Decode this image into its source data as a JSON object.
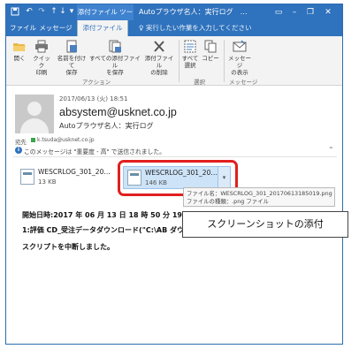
{
  "titlebar": {
    "tool_tab": "添付ファイル ツール",
    "title": "Autoプラウザ名人：実行ログ　…",
    "icons": [
      "save-icon",
      "undo-icon",
      "redo-icon",
      "up-icon",
      "down-icon",
      "customize-icon"
    ],
    "controls": [
      "ribbon-options-icon",
      "minimize-icon",
      "restore-icon",
      "close-icon"
    ]
  },
  "tabs": {
    "file": "ファイル",
    "message": "メッセージ",
    "attachment": "添付ファイル",
    "tellme": "実行したい作業を入力してください"
  },
  "ribbon": {
    "buttons": [
      {
        "label1": "開く",
        "label2": "",
        "icon": "open-folder-icon"
      },
      {
        "label1": "クイック",
        "label2": "印刷",
        "icon": "printer-icon"
      },
      {
        "label1": "名前を付けて",
        "label2": "保存",
        "icon": "save-as-icon"
      },
      {
        "label1": "すべての添付ファイル",
        "label2": "を保存",
        "icon": "save-all-icon"
      },
      {
        "label1": "添付ファイル",
        "label2": "の削除",
        "icon": "delete-x-icon"
      },
      {
        "label1": "すべて",
        "label2": "選択",
        "icon": "select-all-icon"
      },
      {
        "label1": "コピー",
        "label2": "",
        "icon": "copy-icon"
      },
      {
        "label1": "メッセージ",
        "label2": "の表示",
        "icon": "show-message-icon"
      }
    ],
    "groups": {
      "action": "アクション",
      "select": "選択",
      "message": "メッセージ"
    }
  },
  "header": {
    "datetime": "2017/06/13 (火) 18:51",
    "sender": "absystem@usknet.co.jp",
    "subject": "Autoプラウザ名人：実行ログ",
    "to_label": "宛先",
    "to_addr": "k.tsuda@usknet.co.jp",
    "importance": "このメッセージは \"重要度 - 高\" で送信されました。"
  },
  "attachments": [
    {
      "name": "WESCRLOG_301_20…",
      "size": "13 KB"
    },
    {
      "name": "WESCRLOG_301_20…",
      "size": "146 KB"
    }
  ],
  "tooltip": {
    "line1": "ファイル名：WESCRLOG_301_20170613185019.png",
    "line2": "ファイルの種類：.png ファイル"
  },
  "body": {
    "line1": "開始日時:2017 年 06 月 13 日  18 時 50 分 19 秒",
    "line2": "1:評価 CD_受注データダウンロード(\"C:\\AB ダウンロード\")",
    "line3": "スクリプトを中断しました。"
  },
  "callout": "スクリーンショットの添付",
  "colors": {
    "accent": "#2f72bd",
    "highlight_border": "#e0201e",
    "selected_attachment": "#cde3f7"
  }
}
